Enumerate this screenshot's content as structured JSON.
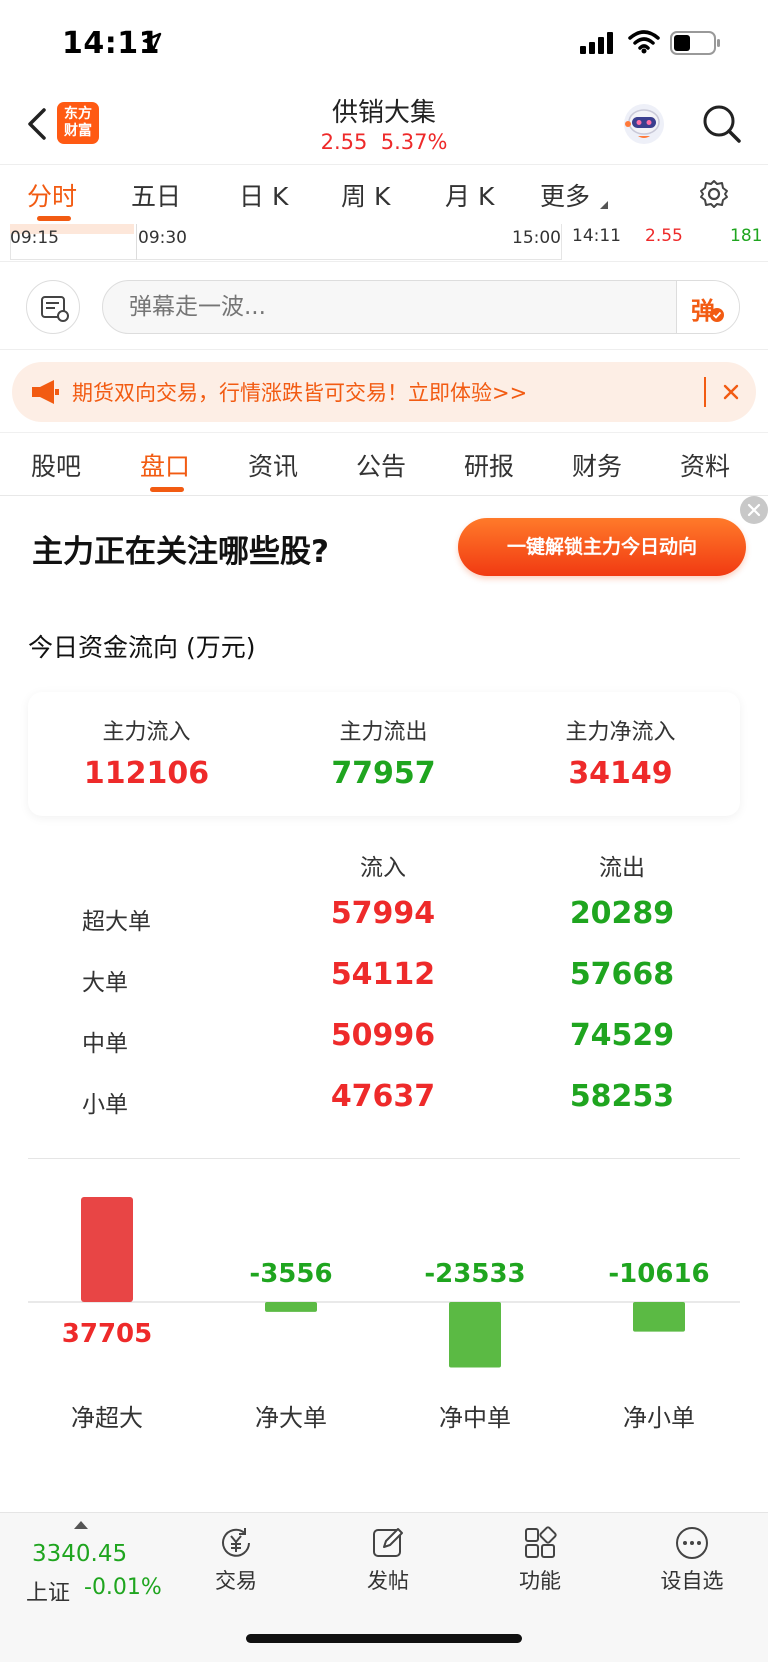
{
  "status_bar": {
    "time": "14:11"
  },
  "header": {
    "stock_name": "供销大集",
    "price": "2.55",
    "change_pct": "5.37%",
    "logo_text_line1": "东方",
    "logo_text_line2": "财富"
  },
  "chart_tabs": [
    {
      "label": "分时",
      "active": true
    },
    {
      "label": "五日"
    },
    {
      "label": "日 K"
    },
    {
      "label": "周 K"
    },
    {
      "label": "月 K"
    },
    {
      "label": "更多"
    }
  ],
  "timeline": {
    "start": "09:15",
    "open": "09:30",
    "close": "15:00",
    "current_time": "14:11",
    "current_price": "2.55",
    "volume": "181"
  },
  "danmu": {
    "placeholder": "弹幕走一波...",
    "toggle_label": "弹"
  },
  "promo": {
    "text": "期货双向交易，行情涨跌皆可交易！立即体验>>"
  },
  "sub_tabs": [
    {
      "label": "股吧"
    },
    {
      "label": "盘口",
      "active": true
    },
    {
      "label": "资讯"
    },
    {
      "label": "公告"
    },
    {
      "label": "研报"
    },
    {
      "label": "财务"
    },
    {
      "label": "资料"
    }
  ],
  "ad": {
    "title": "主力正在关注哪些股?",
    "button": "一键解锁主力今日动向"
  },
  "fund_flow": {
    "title": "今日资金流向 (万元)",
    "summary": [
      {
        "label": "主力流入",
        "value": "112106",
        "color": "red"
      },
      {
        "label": "主力流出",
        "value": "77957",
        "color": "green"
      },
      {
        "label": "主力净流入",
        "value": "34149",
        "color": "red"
      }
    ],
    "table": {
      "headers": [
        "流入",
        "流出"
      ],
      "rows": [
        {
          "label": "超大单",
          "in": "57994",
          "out": "20289"
        },
        {
          "label": "大单",
          "in": "54112",
          "out": "57668"
        },
        {
          "label": "中单",
          "in": "50996",
          "out": "74529"
        },
        {
          "label": "小单",
          "in": "47637",
          "out": "58253"
        }
      ]
    }
  },
  "chart_data": {
    "type": "bar",
    "categories": [
      "净超大",
      "净大单",
      "净中单",
      "净小单"
    ],
    "values": [
      37705,
      -3556,
      -23533,
      -10616
    ],
    "labels": [
      "37705",
      "-3556",
      "-23533",
      "-10616"
    ],
    "colors": {
      "positive": "#e84545",
      "negative": "#5bba44"
    }
  },
  "bottom_nav": {
    "index_value": "3340.45",
    "index_name": "上证",
    "index_change": "-0.01%",
    "items": [
      {
        "label": "交易",
        "icon": "trade-icon"
      },
      {
        "label": "发帖",
        "icon": "post-icon"
      },
      {
        "label": "功能",
        "icon": "functions-icon"
      },
      {
        "label": "设自选",
        "icon": "add-watchlist-icon"
      }
    ]
  }
}
